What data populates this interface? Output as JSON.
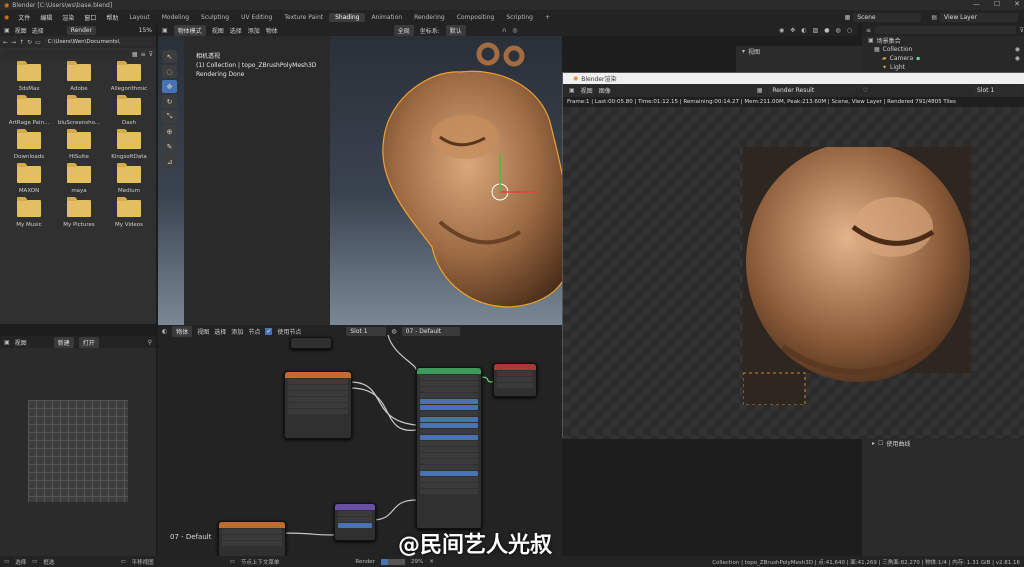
{
  "titlebar": {
    "title": "Blender [C:\\Users\\ws\\base.blend]",
    "minimize": "—",
    "maximize": "☐",
    "close": "✕"
  },
  "menu": {
    "file": "文件",
    "edit": "编辑",
    "render": "渲染",
    "window": "窗口",
    "help": "帮助"
  },
  "workspaces": [
    "Layout",
    "Modeling",
    "Sculpting",
    "UV Editing",
    "Texture Paint",
    "Shading",
    "Animation",
    "Rendering",
    "Compositing",
    "Scripting"
  ],
  "active_workspace": "Shading",
  "add_workspace": "+",
  "scene": {
    "label": "Scene",
    "view_layer": "View Layer"
  },
  "filebrowser": {
    "header": {
      "view": "视图",
      "select": "选择",
      "render_label": "Render",
      "zoom": "15%"
    },
    "path": "C:\\Users\\Wen\\Documents\\",
    "folders": [
      "3dsMax",
      "Adobe",
      "Allegorithmic",
      "ArtRage Pain...",
      "bluScreensho...",
      "Dash",
      "Downloads",
      "HiSuite",
      "KingsoftData",
      "MAXON",
      "maya",
      "Medium",
      "My Music",
      "My Pictures",
      "My Videos"
    ]
  },
  "texpanel": {
    "view": "视图",
    "new": "新建",
    "open": "打开"
  },
  "viewport": {
    "mode": "物体模式",
    "menu": [
      "视图",
      "选择",
      "添加",
      "物体"
    ],
    "orientation": "全局",
    "pivot": "坐标系:",
    "snap": "默认",
    "info_line1": "相机透视",
    "info_line2": "(1) Collection | topo_ZBrushPolyMesh3D",
    "info_line3": "Rendering Done"
  },
  "nodeeditor": {
    "object": "物体",
    "menu": [
      "视图",
      "选择",
      "添加",
      "节点"
    ],
    "use_nodes": "使用节点",
    "slot": "Slot 1",
    "material": "07 - Default",
    "frame_label": "07 - Default"
  },
  "render_window": {
    "title": "Blender渲染",
    "menu": [
      "视图",
      "图像"
    ],
    "image_name": "Render Result",
    "slot": "Slot 1",
    "info": "Frame:1 | Last:00:05.80 | Time:01:12.15 | Remaining:00:14.27 | Mem:211.00M, Peak:213.60M | Scene, View Layer | Rendered 791/4805 Tiles"
  },
  "outliner": {
    "root": "场景集合",
    "collection": "Collection",
    "camera": "Camera",
    "light": "Light"
  },
  "viewport_n_panel": {
    "view": "视图"
  },
  "props_panel": {
    "item": "使用曲线"
  },
  "status": {
    "select": "选择",
    "box": "框选",
    "pan": "平移视图",
    "context": "节点上下文菜单",
    "render": "Render",
    "render_pct": "29%",
    "scene_info": "Collection | topo_ZBrushPolyMesh3D | 点:41,640 | 面:41,269 | 三角面:82,270 | 物体:1/4 | 内存: 1.31 GiB | v2.81.16"
  },
  "watermark": "@民间艺人光叔"
}
